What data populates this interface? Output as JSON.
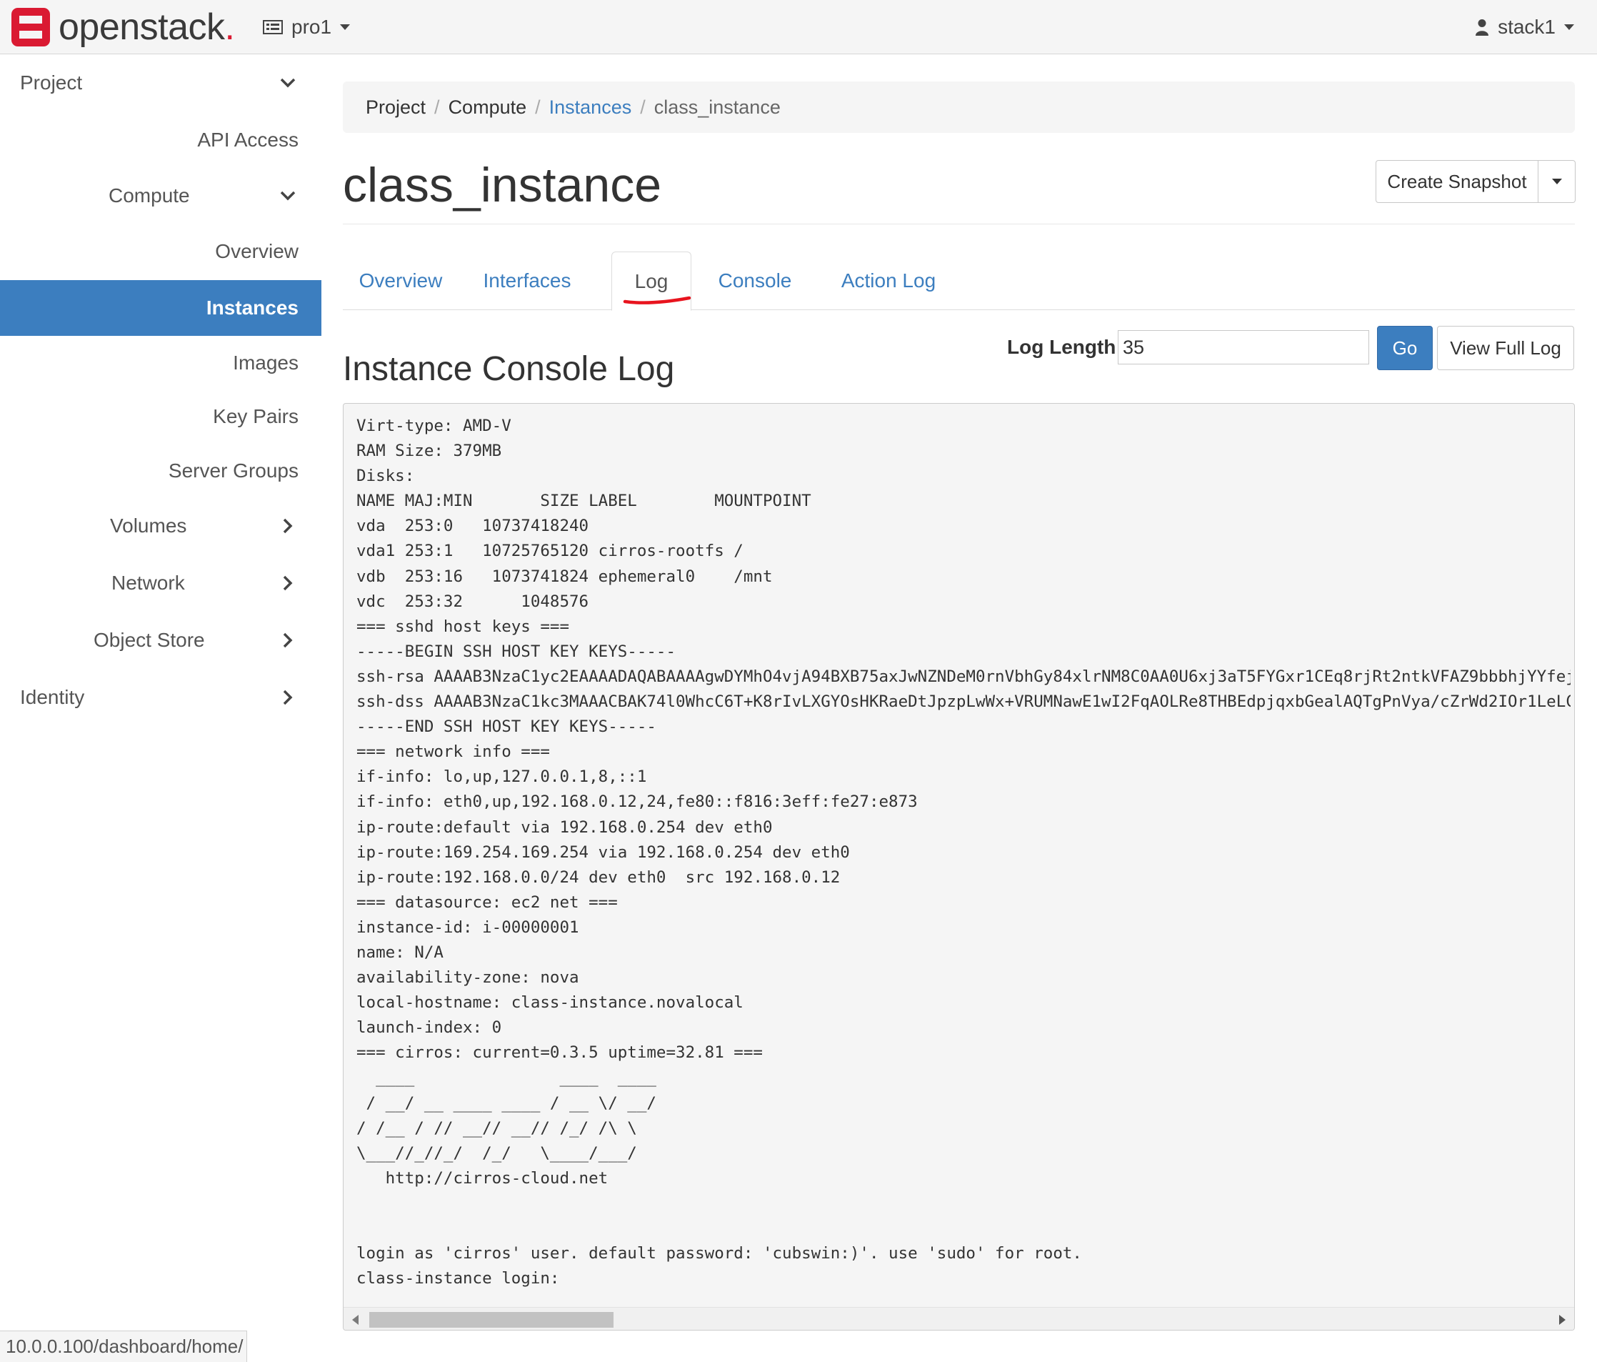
{
  "brand": {
    "name": "openstack",
    "dot": "."
  },
  "header": {
    "project": "pro1",
    "user": "stack1"
  },
  "sidebar": {
    "items": [
      {
        "label": "Project"
      },
      {
        "label": "API Access"
      },
      {
        "label": "Compute"
      },
      {
        "label": "Overview"
      },
      {
        "label": "Instances"
      },
      {
        "label": "Images"
      },
      {
        "label": "Key Pairs"
      },
      {
        "label": "Server Groups"
      },
      {
        "label": "Volumes"
      },
      {
        "label": "Network"
      },
      {
        "label": "Object Store"
      },
      {
        "label": "Identity"
      }
    ]
  },
  "breadcrumb": {
    "project": "Project",
    "compute": "Compute",
    "instances": "Instances",
    "current": "class_instance",
    "sep": "/"
  },
  "page": {
    "title": "class_instance",
    "create_snapshot": "Create Snapshot"
  },
  "tabs": [
    {
      "label": "Overview"
    },
    {
      "label": "Interfaces"
    },
    {
      "label": "Log"
    },
    {
      "label": "Console"
    },
    {
      "label": "Action Log"
    }
  ],
  "log": {
    "section_title": "Instance Console Log",
    "length_label": "Log Length",
    "length_value": "35",
    "go_label": "Go",
    "full_label": "View Full Log",
    "text": "Virt-type: AMD-V\nRAM Size: 379MB\nDisks:\nNAME MAJ:MIN       SIZE LABEL        MOUNTPOINT\nvda  253:0   10737418240\nvda1 253:1   10725765120 cirros-rootfs /\nvdb  253:16   1073741824 ephemeral0    /mnt\nvdc  253:32      1048576\n=== sshd host keys ===\n-----BEGIN SSH HOST KEY KEYS-----\nssh-rsa AAAAB3NzaC1yc2EAAAADAQABAAAAgwDYMhO4vjA94BXB75axJwNZNDeM0rnVbhGy84xlrNM8C0AA0U6xj3aT5FYGxr1CEq8rjRt2ntkVFAZ9bbbhjYYfej\nssh-dss AAAAB3NzaC1kc3MAAACBAK74l0WhcC6T+K8rIvLXGYOsHKRaeDtJpzpLwWx+VRUMNawE1wI2FqAOLRe8THBEdpjqxbGealAQTgPnVya/cZrWd2IOr1LeLC\n-----END SSH HOST KEY KEYS-----\n=== network info ===\nif-info: lo,up,127.0.0.1,8,::1\nif-info: eth0,up,192.168.0.12,24,fe80::f816:3eff:fe27:e873\nip-route:default via 192.168.0.254 dev eth0\nip-route:169.254.169.254 via 192.168.0.254 dev eth0\nip-route:192.168.0.0/24 dev eth0  src 192.168.0.12\n=== datasource: ec2 net ===\ninstance-id: i-00000001\nname: N/A\navailability-zone: nova\nlocal-hostname: class-instance.novalocal\nlaunch-index: 0\n=== cirros: current=0.3.5 uptime=32.81 ===\n  ____               ____  ____\n / __/ __ ____ ____ / __ \\/ __/\n/ /__ / // __// __// /_/ /\\ \\\n\\___//_//_/  /_/   \\____/___/\n   http://cirros-cloud.net\n\n\nlogin as 'cirros' user. default password: 'cubswin:)'. use 'sudo' for root.\nclass-instance login:"
  },
  "status_bar": {
    "url": "10.0.0.100/dashboard/home/"
  },
  "colors": {
    "accent": "#3c7ebf",
    "brand_red": "#da1a32",
    "annotation_red": "#e8141e"
  }
}
